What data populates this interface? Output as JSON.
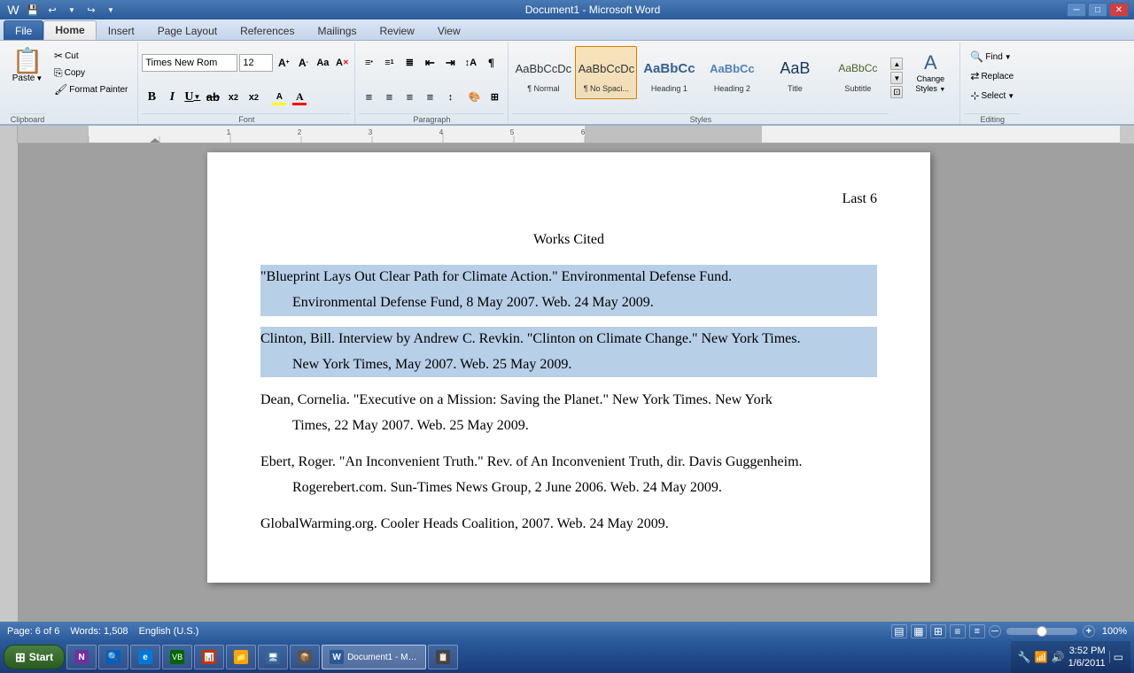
{
  "titlebar": {
    "title": "Document1 - Microsoft Word",
    "minimize": "─",
    "restore": "□",
    "close": "✕"
  },
  "quickaccess": {
    "save": "💾",
    "undo": "↩",
    "redo": "↪",
    "customize": "▼"
  },
  "tabs": [
    {
      "id": "file",
      "label": "File"
    },
    {
      "id": "home",
      "label": "Home",
      "active": true
    },
    {
      "id": "insert",
      "label": "Insert"
    },
    {
      "id": "pagelayout",
      "label": "Page Layout"
    },
    {
      "id": "references",
      "label": "References"
    },
    {
      "id": "mailings",
      "label": "Mailings"
    },
    {
      "id": "review",
      "label": "Review"
    },
    {
      "id": "view",
      "label": "View"
    }
  ],
  "ribbon": {
    "clipboard": {
      "label": "Clipboard",
      "paste_label": "Paste",
      "cut_label": "Cut",
      "copy_label": "Copy",
      "format_painter_label": "Format Painter"
    },
    "font": {
      "label": "Font",
      "font_name": "Times New Rom",
      "font_size": "12",
      "bold": "B",
      "italic": "I",
      "underline": "U",
      "strikethrough": "ab",
      "subscript": "x₂",
      "superscript": "x²",
      "grow": "A",
      "shrink": "A",
      "change_case": "Aa",
      "clear": "A"
    },
    "paragraph": {
      "label": "Paragraph"
    },
    "styles": {
      "label": "Styles",
      "items": [
        {
          "id": "normal",
          "preview": "AaBbCcDc",
          "label": "¶ Normal"
        },
        {
          "id": "nospace",
          "preview": "AaBbCcDc",
          "label": "¶ No Spaci...",
          "selected": true
        },
        {
          "id": "heading1",
          "preview": "AaBbCc",
          "label": "Heading 1"
        },
        {
          "id": "heading2",
          "preview": "AaBbCc",
          "label": "Heading 2"
        },
        {
          "id": "title",
          "preview": "AaB",
          "label": "Title"
        },
        {
          "id": "subtitle",
          "preview": "AaBbCc",
          "label": "Subtitle"
        }
      ],
      "change_styles_label": "Change\nStyles"
    },
    "editing": {
      "label": "Editing",
      "find_label": "Find",
      "replace_label": "Replace",
      "select_label": "Select"
    }
  },
  "document": {
    "page_number": "Last 6",
    "title": "Works Cited",
    "entries": [
      {
        "line1": "\"Blueprint Lays Out Clear Path for Climate Action.\" Environmental Defense Fund.",
        "line2": "Environmental Defense Fund, 8 May 2007. Web. 24 May 2009.",
        "selected": true
      },
      {
        "line1": "Clinton, Bill. Interview by Andrew C. Revkin. \"Clinton on Climate Change.\" New York Times.",
        "line2": "New York Times, May 2007. Web. 25 May 2009.",
        "selected": true
      },
      {
        "line1": "Dean, Cornelia. \"Executive on a Mission: Saving the Planet.\" New York Times. New York",
        "line2": "Times, 22 May 2007. Web. 25 May 2009.",
        "selected": false
      },
      {
        "line1": "Ebert, Roger. \"An Inconvenient Truth.\" Rev. of An Inconvenient Truth, dir. Davis Guggenheim.",
        "line2": "Rogerebert.com. Sun-Times News Group, 2 June 2006. Web. 24 May 2009.",
        "selected": false
      },
      {
        "line1": "GlobalWarming.org. Cooler Heads Coalition, 2007. Web. 24 May 2009.",
        "line2": "",
        "selected": false
      }
    ]
  },
  "statusbar": {
    "page": "Page: 6 of 6",
    "words": "Words: 1,508",
    "language": "English (U.S.)",
    "view_normal": "▤",
    "view_layout": "▦",
    "view_web": "⊞",
    "view_outline": "≡",
    "view_draft": "≡",
    "zoom": "100%",
    "zoom_out": "─",
    "zoom_in": "+"
  },
  "taskbar": {
    "start_label": "Start",
    "time": "3:52 PM",
    "date": "1/6/2011",
    "items": [
      {
        "icon": "📓",
        "label": ""
      },
      {
        "icon": "🔍",
        "label": ""
      },
      {
        "icon": "⚙",
        "label": ""
      },
      {
        "icon": "🌐",
        "label": ""
      },
      {
        "icon": "📊",
        "label": ""
      },
      {
        "icon": "📋",
        "label": ""
      },
      {
        "icon": "📁",
        "label": ""
      },
      {
        "icon": "🖥",
        "label": ""
      },
      {
        "icon": "💬",
        "label": ""
      },
      {
        "icon": "📝",
        "label": ""
      },
      {
        "icon": "✉",
        "label": ""
      },
      {
        "icon": "📦",
        "label": ""
      }
    ]
  }
}
